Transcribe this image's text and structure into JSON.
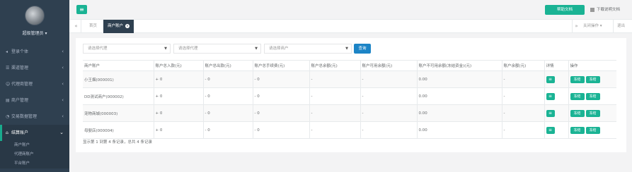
{
  "sidebar": {
    "profile_name": "超级管理员 ▾",
    "items": [
      {
        "label": "登录个体",
        "icon": "user-icon"
      },
      {
        "label": "渠道管理",
        "icon": "list-icon"
      },
      {
        "label": "代理商管理",
        "icon": "user-group-icon"
      },
      {
        "label": "商户管理",
        "icon": "store-icon"
      },
      {
        "label": "交易数据管理",
        "icon": "chart-icon"
      },
      {
        "label": "结算账户",
        "icon": "bank-icon"
      }
    ],
    "sub_items": [
      "商户账户",
      "代理商账户",
      "平台账户"
    ]
  },
  "topbar": {
    "help_label": "帮助文档",
    "download_label": "下载说明文档"
  },
  "tabs": {
    "home_label": "首页",
    "active_label": "商户账户",
    "ops_label": "关闭操作 ▾",
    "exit_label": "退出"
  },
  "filters": {
    "select1": "请选择代理",
    "select2": "请选择代理",
    "select3": "请选择商户",
    "query_label": "查询"
  },
  "table": {
    "headers": [
      "商户账户",
      "账户总入款(元)",
      "账户总出款(元)",
      "账户总手续费(元)",
      "账户总余额(元)",
      "账户可用余额(元)",
      "账户不可用余额(冻结资金)(元)",
      "账户余额(元)",
      "详情",
      "操作"
    ],
    "rows": [
      {
        "name": "小王烟(000001)",
        "in": "+ 0",
        "out": "- 0",
        "fee": "- 0",
        "total": "-",
        "available": "-",
        "unavailable": "0.00",
        "balance": "-"
      },
      {
        "name": "DD测试商户(000002)",
        "in": "+ 0",
        "out": "- 0",
        "fee": "- 0",
        "total": "-",
        "available": "-",
        "unavailable": "0.00",
        "balance": "-"
      },
      {
        "name": "宠物商城(000003)",
        "in": "+ 0",
        "out": "- 0",
        "fee": "- 0",
        "total": "-",
        "available": "-",
        "unavailable": "0.00",
        "balance": "-"
      },
      {
        "name": "母婴店(000004)",
        "in": "+ 0",
        "out": "- 0",
        "fee": "- 0",
        "total": "-",
        "available": "-",
        "unavailable": "0.00",
        "balance": "-"
      }
    ],
    "op1": "冻结",
    "op2": "冻结"
  },
  "pagination_info": "显示第 1 到第 4 条记录，总共 4 条记录",
  "colors": {
    "primary": "#1ab394",
    "sidebar": "#2f4050",
    "query": "#1c84c6"
  }
}
